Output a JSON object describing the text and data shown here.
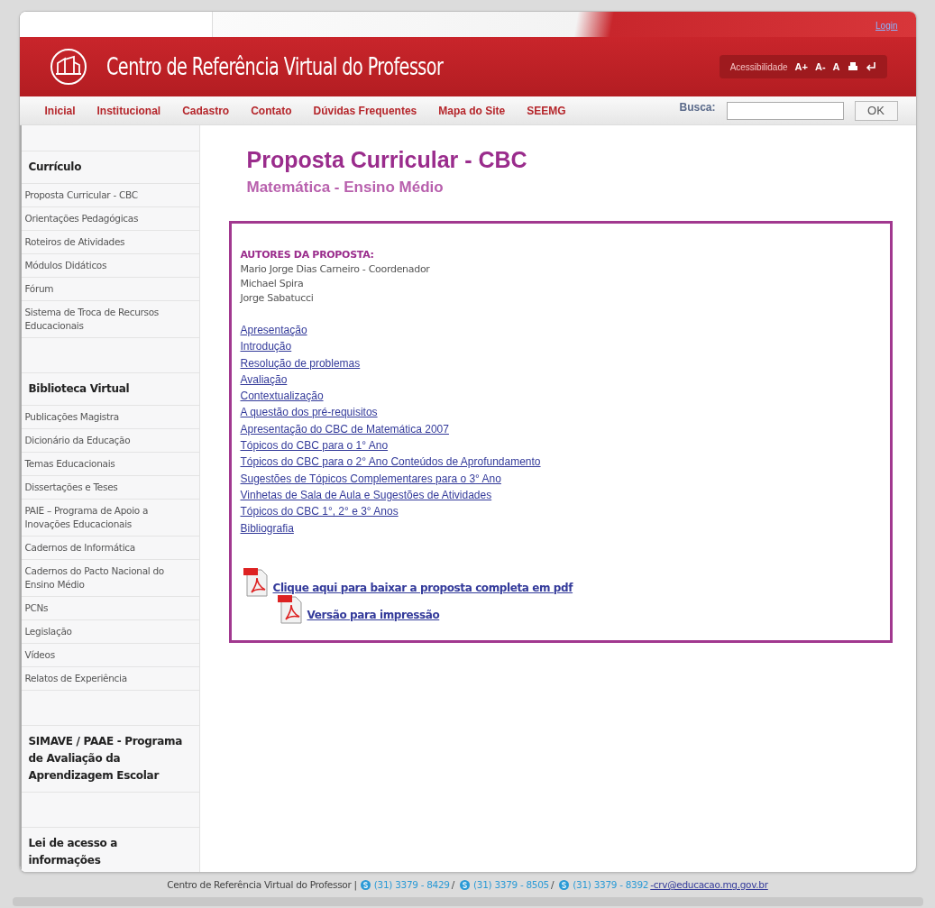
{
  "header": {
    "login": "Login",
    "site_title": "Centro de Referência Virtual do Professor",
    "accessibility": {
      "label": "Acessibilidade",
      "buttons": [
        "A+",
        "A-",
        "A"
      ]
    }
  },
  "nav": {
    "items": [
      "Inicial",
      "Institucional",
      "Cadastro",
      "Contato",
      "Dúvidas Frequentes",
      "Mapa do Site",
      "SEEMG"
    ],
    "search_label": "Busca:",
    "search_button": "OK"
  },
  "sidebar": {
    "sections": [
      {
        "title": "Currículo",
        "items": [
          "Proposta Curricular - CBC",
          "Orientações Pedagógicas",
          "Roteiros de Atividades",
          "Módulos Didáticos",
          "Fórum",
          "Sistema de Troca de Recursos Educacionais"
        ]
      },
      {
        "title": "Biblioteca Virtual",
        "items": [
          "Publicações Magistra",
          "Dicionário da Educação",
          "Temas Educacionais",
          "Dissertações e Teses",
          "PAIE – Programa de Apoio a Inovações Educacionais",
          "Cadernos de Informática",
          "Cadernos do Pacto Nacional do Ensino Médio",
          "PCNs",
          "Legislação",
          "Vídeos",
          "Relatos de Experiência"
        ]
      },
      {
        "title": "SIMAVE / PAAE - Programa de Avaliação da Aprendizagem Escolar"
      },
      {
        "title": "Lei de acesso a informações"
      }
    ]
  },
  "content": {
    "title": "Proposta Curricular - CBC",
    "subtitle": "Matemática - Ensino Médio",
    "authors_heading": "AUTORES DA PROPOSTA:",
    "authors": [
      "Mario Jorge Dias Carneiro - Coordenador",
      "Michael Spira",
      "Jorge Sabatucci"
    ],
    "links": [
      "Apresentação",
      "Introdução",
      "Resolução de problemas",
      "Avaliação",
      "Contextualização",
      "A questão dos pré-requisitos",
      "Apresentação do CBC de Matemática 2007",
      "Tópicos do CBC para o 1° Ano",
      "Tópicos do CBC para o 2° Ano Conteúdos de Aprofundamento",
      "Sugestões de Tópicos Complementares para o 3° Ano",
      "Vinhetas de Sala de Aula e Sugestões de Atividades",
      "Tópicos do CBC 1°, 2° e 3° Anos",
      "Bibliografia"
    ],
    "downloads": [
      "Clique aqui para baixar a proposta completa em pdf",
      "Versão para impressão"
    ]
  },
  "footer": {
    "site": "Centro de Referência Virtual do Professor |",
    "phones": [
      "(31) 3379 - 8429",
      "(31) 3379 - 8505",
      "(31) 3379 - 8392"
    ],
    "separator": "/",
    "email": "-crv@educacao.mg.gov.br"
  }
}
